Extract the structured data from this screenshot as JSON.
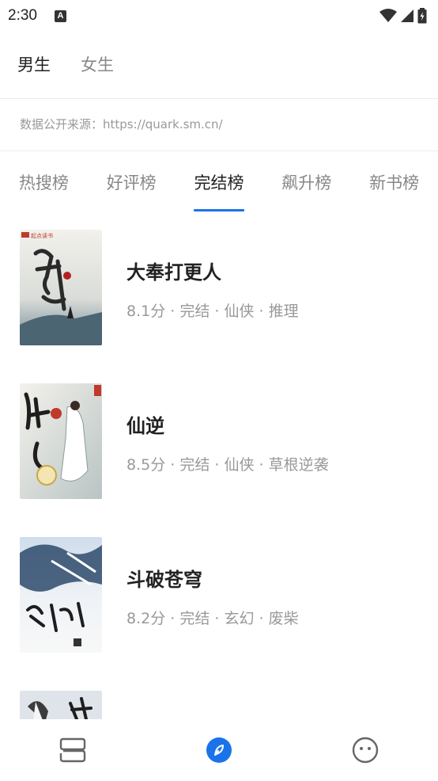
{
  "status_bar": {
    "time": "2:30",
    "notification_icon_label": "A",
    "icons": [
      "wifi-icon",
      "signal-icon",
      "battery-icon"
    ]
  },
  "gender_tabs": [
    {
      "label": "男生",
      "active": true
    },
    {
      "label": "女生",
      "active": false
    }
  ],
  "source_note": "数据公开来源：https://quark.sm.cn/",
  "rank_tabs": [
    {
      "label": "热搜榜",
      "active": false
    },
    {
      "label": "好评榜",
      "active": false
    },
    {
      "label": "完结榜",
      "active": true
    },
    {
      "label": "飙升榜",
      "active": false
    },
    {
      "label": "新书榜",
      "active": false
    }
  ],
  "books": [
    {
      "title": "大奉打更人",
      "meta": "8.1分 · 完结 · 仙侠 · 推理",
      "cover_label": "起点读书"
    },
    {
      "title": "仙逆",
      "meta": "8.5分 · 完结 · 仙侠 · 草根逆袭",
      "cover_label": ""
    },
    {
      "title": "斗破苍穹",
      "meta": "8.2分 · 完结 · 玄幻 · 废柴",
      "cover_label": ""
    },
    {
      "title": "",
      "meta": "",
      "cover_label": ""
    }
  ],
  "bottom_nav": [
    {
      "icon": "bookshelf-icon",
      "active": false
    },
    {
      "icon": "compass-icon",
      "active": true
    },
    {
      "icon": "smiley-icon",
      "active": false
    }
  ],
  "colors": {
    "accent": "#1a73e8",
    "text_primary": "#222222",
    "text_secondary": "#999999",
    "tab_inactive": "#888888"
  }
}
